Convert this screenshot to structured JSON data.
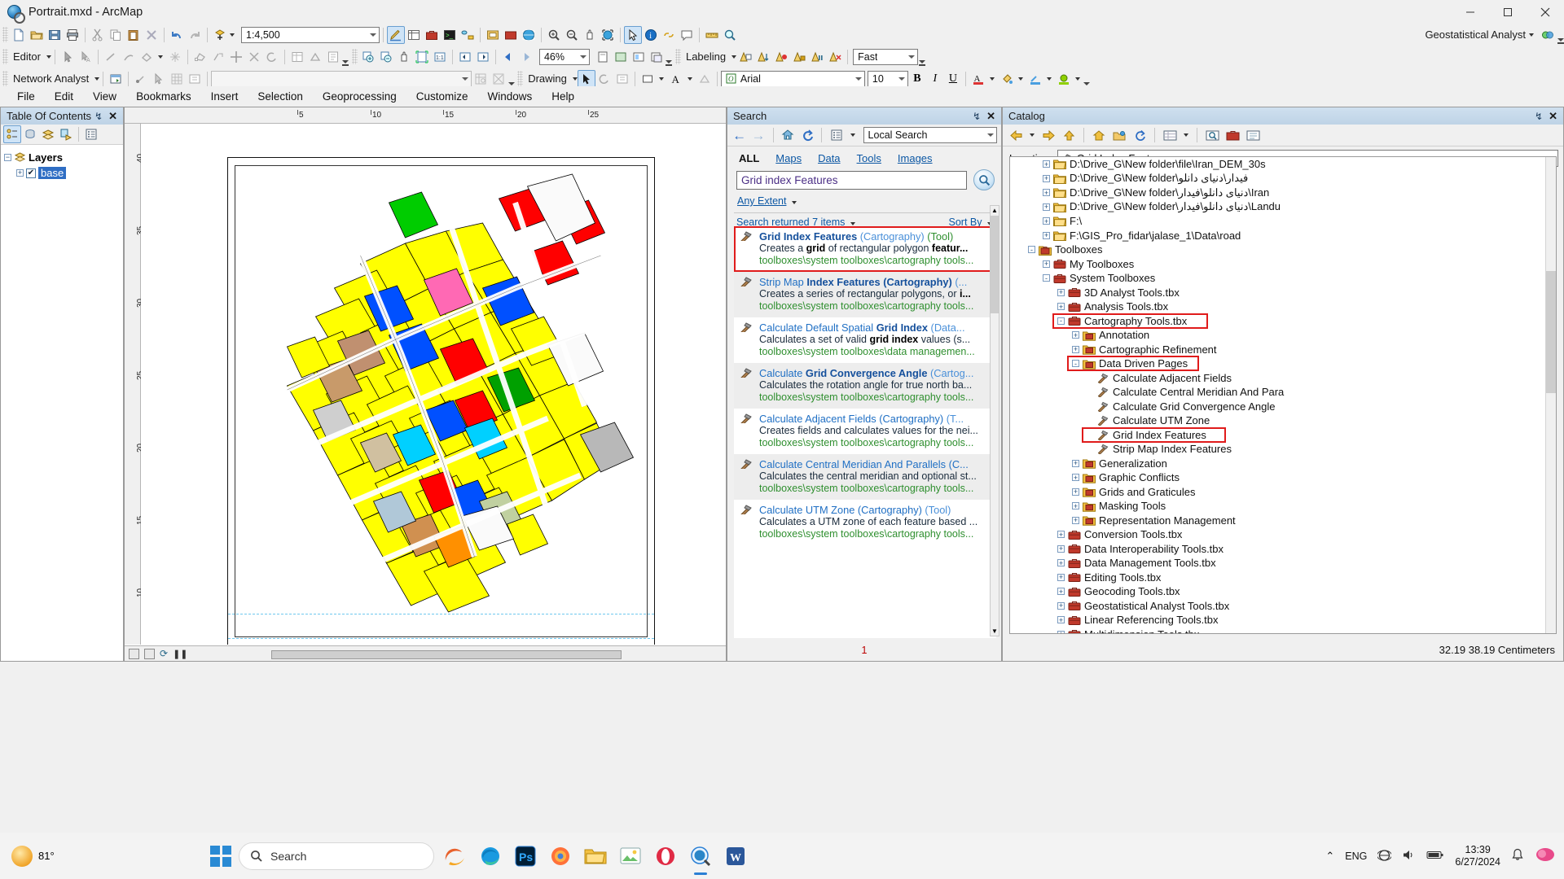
{
  "window": {
    "title": "Portrait.mxd - ArcMap",
    "app_icon": "arcmap-globe-icon",
    "minimize": "–",
    "maximize": "☐",
    "close": "✕"
  },
  "standard_toolbar": {
    "scale_value": "1:4,500",
    "buttons": [
      "new-document-icon",
      "open-folder-icon",
      "save-icon",
      "print-icon",
      "cut-icon",
      "copy-icon",
      "paste-icon",
      "delete-icon",
      "undo-icon",
      "redo-icon",
      "add-data-icon"
    ]
  },
  "editor_toolbar": {
    "label": "Editor",
    "zoom_value": "46%",
    "labeling_label": "Labeling",
    "fast_label": "Fast"
  },
  "network_toolbar": {
    "label": "Network Analyst",
    "combo_value": ""
  },
  "drawing_toolbar": {
    "label": "Drawing",
    "font_name": "Arial",
    "font_size": "10",
    "bold": "B",
    "italic": "I",
    "underline": "U"
  },
  "geostat_toolbar": {
    "label": "Geostatistical Analyst"
  },
  "menubar": {
    "items": [
      "File",
      "Edit",
      "View",
      "Bookmarks",
      "Insert",
      "Selection",
      "Geoprocessing",
      "Customize",
      "Windows",
      "Help"
    ]
  },
  "toc": {
    "title": "Table Of Contents",
    "pin": "↯",
    "close": "✕",
    "tool_buttons": [
      "list-by-drawing-order-icon",
      "list-by-source-icon",
      "list-by-visibility-icon",
      "list-by-selection-icon",
      "options-icon"
    ],
    "root": "Layers",
    "layers": [
      {
        "name": "base",
        "checked": true,
        "selected": true
      }
    ]
  },
  "map": {
    "ruler_top_ticks": [
      "5",
      "10",
      "15",
      "20",
      "25"
    ],
    "ruler_left_ticks": [
      "40",
      "35",
      "30",
      "25",
      "20",
      "15",
      "10"
    ],
    "status_buttons": [
      "layout-view-icon",
      "data-view-icon",
      "refresh-icon",
      "pause-icon"
    ]
  },
  "search": {
    "title": "Search",
    "pin": "↯",
    "close": "✕",
    "back": "←",
    "forward": "→",
    "home": "home-icon",
    "refresh": "refresh-icon",
    "scope_value": "Local Search",
    "tabs": [
      {
        "label": "ALL",
        "active": true
      },
      {
        "label": "Maps",
        "active": false
      },
      {
        "label": "Data",
        "active": false
      },
      {
        "label": "Tools",
        "active": false
      },
      {
        "label": "Images",
        "active": false
      }
    ],
    "query": "Grid index Features",
    "query_placeholder": "Search",
    "search_button": "search-magnifier-icon",
    "extent_filter": "Any Extent",
    "results_count_label": "Search returned 7 items",
    "sort_by_label": "Sort By",
    "page_number": "1",
    "results": [
      {
        "title_bold": "Grid Index Features",
        "title_rest": " (Cartography)",
        "title_type": " (Tool)",
        "desc_pre": "Creates a ",
        "desc_bold": "grid",
        "desc_post": " of rectangular polygon ",
        "desc_bold2": "featur...",
        "path": "toolboxes\\system toolboxes\\cartography tools...",
        "highlighted": true
      },
      {
        "title_bold": "Strip Map ",
        "title_rest": "Index Features (Cartography)",
        "title_type": " (...",
        "desc_pre": "Creates a series of rectangular polygons, or ",
        "desc_bold": "i...",
        "desc_post": "",
        "desc_bold2": "",
        "path": "toolboxes\\system toolboxes\\cartography tools...",
        "highlighted": false
      },
      {
        "title_bold": "Calculate Default Spatial ",
        "title_rest": "Grid Index",
        "title_type": " (Data...",
        "desc_pre": "Calculates a set of valid ",
        "desc_bold": "grid index",
        "desc_post": " values (s...",
        "desc_bold2": "",
        "path": "toolboxes\\system toolboxes\\data managemen...",
        "highlighted": false
      },
      {
        "title_bold": "Calculate ",
        "title_rest": "Grid Convergence Angle",
        "title_type": " (Cartog...",
        "desc_pre": "Calculates the rotation angle for true north ba...",
        "desc_bold": "",
        "desc_post": "",
        "desc_bold2": "",
        "path": "toolboxes\\system toolboxes\\cartography tools...",
        "highlighted": false
      },
      {
        "title_bold": "Calculate Adjacent Fields ",
        "title_rest": "(Cartography)",
        "title_type": " (T...",
        "desc_pre": "Creates fields and calculates values for the nei...",
        "desc_bold": "",
        "desc_post": "",
        "desc_bold2": "",
        "path": "toolboxes\\system toolboxes\\cartography tools...",
        "highlighted": false
      },
      {
        "title_bold": "Calculate Central Meridian And Parallels ",
        "title_rest": "(C...",
        "title_type": "",
        "desc_pre": "Calculates the central meridian and optional st...",
        "desc_bold": "",
        "desc_post": "",
        "desc_bold2": "",
        "path": "toolboxes\\system toolboxes\\cartography tools...",
        "highlighted": false
      },
      {
        "title_bold": "Calculate UTM Zone ",
        "title_rest": "(Cartography)",
        "title_type": " (Tool)",
        "desc_pre": "Calculates a UTM zone of each feature based ...",
        "desc_bold": "",
        "desc_post": "",
        "desc_bold2": "",
        "path": "toolboxes\\system toolboxes\\cartography tools...",
        "highlighted": false
      }
    ]
  },
  "catalog": {
    "title": "Catalog",
    "pin": "↯",
    "close": "✕",
    "location_label": "Location:",
    "location_value": "Grid Index Features",
    "status": "32.19  38.19 Centimeters",
    "tree": [
      {
        "label": "D:\\Drive_G\\New folder\\file\\Iran_DEM_30s",
        "depth": 2,
        "toggle": "+",
        "icon": "folder-icon"
      },
      {
        "label": "D:\\Drive_G\\New folder\\فیدار\\دنیای دانلو",
        "depth": 2,
        "toggle": "+",
        "icon": "folder-icon"
      },
      {
        "label": "D:\\Drive_G\\New folder\\دنیای دانلو\\فیدار\\Iran",
        "depth": 2,
        "toggle": "+",
        "icon": "folder-icon"
      },
      {
        "label": "D:\\Drive_G\\New folder\\دنیای دانلو\\فیدار\\Landu",
        "depth": 2,
        "toggle": "+",
        "icon": "folder-icon"
      },
      {
        "label": "F:\\",
        "depth": 2,
        "toggle": "+",
        "icon": "folder-icon"
      },
      {
        "label": "F:\\GIS_Pro_fidar\\jalase_1\\Data\\road",
        "depth": 2,
        "toggle": "+",
        "icon": "folder-icon"
      },
      {
        "label": "Toolboxes",
        "depth": 1,
        "toggle": "-",
        "icon": "toolbox-folder-icon"
      },
      {
        "label": "My Toolboxes",
        "depth": 2,
        "toggle": "+",
        "icon": "toolbox-icon"
      },
      {
        "label": "System Toolboxes",
        "depth": 2,
        "toggle": "-",
        "icon": "toolbox-icon"
      },
      {
        "label": "3D Analyst Tools.tbx",
        "depth": 3,
        "toggle": "+",
        "icon": "toolbox-icon"
      },
      {
        "label": "Analysis Tools.tbx",
        "depth": 3,
        "toggle": "+",
        "icon": "toolbox-icon"
      },
      {
        "label": "Cartography Tools.tbx",
        "depth": 3,
        "toggle": "-",
        "icon": "toolbox-icon",
        "highlighted": true
      },
      {
        "label": "Annotation",
        "depth": 4,
        "toggle": "+",
        "icon": "toolset-icon"
      },
      {
        "label": "Cartographic Refinement",
        "depth": 4,
        "toggle": "+",
        "icon": "toolset-icon"
      },
      {
        "label": "Data Driven Pages",
        "depth": 4,
        "toggle": "-",
        "icon": "toolset-icon",
        "highlighted": true
      },
      {
        "label": "Calculate Adjacent Fields",
        "depth": 5,
        "toggle": "",
        "icon": "hammer-tool-icon"
      },
      {
        "label": "Calculate Central Meridian And Para",
        "depth": 5,
        "toggle": "",
        "icon": "hammer-tool-icon"
      },
      {
        "label": "Calculate Grid Convergence Angle",
        "depth": 5,
        "toggle": "",
        "icon": "hammer-tool-icon"
      },
      {
        "label": "Calculate UTM Zone",
        "depth": 5,
        "toggle": "",
        "icon": "hammer-tool-icon"
      },
      {
        "label": "Grid Index Features",
        "depth": 5,
        "toggle": "",
        "icon": "hammer-tool-icon",
        "highlighted": true
      },
      {
        "label": "Strip Map Index Features",
        "depth": 5,
        "toggle": "",
        "icon": "hammer-tool-icon"
      },
      {
        "label": "Generalization",
        "depth": 4,
        "toggle": "+",
        "icon": "toolset-icon"
      },
      {
        "label": "Graphic Conflicts",
        "depth": 4,
        "toggle": "+",
        "icon": "toolset-icon"
      },
      {
        "label": "Grids and Graticules",
        "depth": 4,
        "toggle": "+",
        "icon": "toolset-icon"
      },
      {
        "label": "Masking Tools",
        "depth": 4,
        "toggle": "+",
        "icon": "toolset-icon"
      },
      {
        "label": "Representation Management",
        "depth": 4,
        "toggle": "+",
        "icon": "toolset-icon"
      },
      {
        "label": "Conversion Tools.tbx",
        "depth": 3,
        "toggle": "+",
        "icon": "toolbox-icon"
      },
      {
        "label": "Data Interoperability Tools.tbx",
        "depth": 3,
        "toggle": "+",
        "icon": "toolbox-icon"
      },
      {
        "label": "Data Management Tools.tbx",
        "depth": 3,
        "toggle": "+",
        "icon": "toolbox-icon"
      },
      {
        "label": "Editing Tools.tbx",
        "depth": 3,
        "toggle": "+",
        "icon": "toolbox-icon"
      },
      {
        "label": "Geocoding Tools.tbx",
        "depth": 3,
        "toggle": "+",
        "icon": "toolbox-icon"
      },
      {
        "label": "Geostatistical Analyst Tools.tbx",
        "depth": 3,
        "toggle": "+",
        "icon": "toolbox-icon"
      },
      {
        "label": "Linear Referencing Tools.tbx",
        "depth": 3,
        "toggle": "+",
        "icon": "toolbox-icon"
      },
      {
        "label": "Multidimension Tools.tbx",
        "depth": 3,
        "toggle": "+",
        "icon": "toolbox-icon"
      }
    ]
  },
  "taskbar": {
    "weather_temp": "81°",
    "search_placeholder": "Search",
    "language": "ENG",
    "time": "13:39",
    "date": "6/27/2024",
    "apps": [
      "edge-dev-icon",
      "edge-icon",
      "photoshop-icon",
      "firefox-icon",
      "file-explorer-icon",
      "photos-icon",
      "opera-icon",
      "arcmap-icon",
      "word-icon"
    ]
  },
  "colors": {
    "accent": "#2a7fd4",
    "highlight_red": "#e01b1b",
    "link_blue": "#0b57a4",
    "path_green": "#2f8f2f",
    "panel_title": "#cfe0ef"
  }
}
